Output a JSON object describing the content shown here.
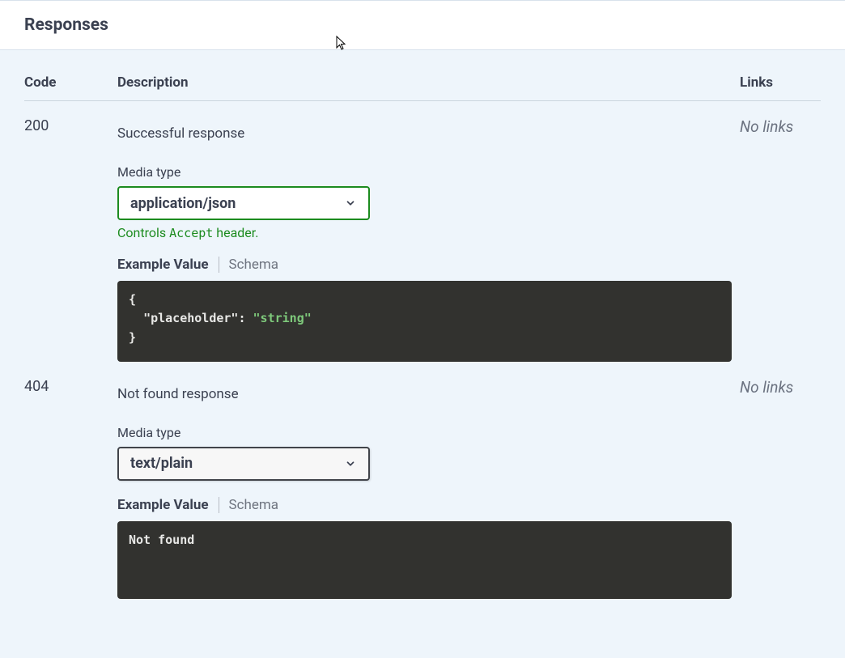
{
  "section_title": "Responses",
  "headers": {
    "code": "Code",
    "description": "Description",
    "links": "Links"
  },
  "responses": [
    {
      "code": "200",
      "description": "Successful response",
      "links": "No links",
      "media_type_label": "Media type",
      "media_type_value": "application/json",
      "media_type_active": true,
      "accept_hint_pre": "Controls ",
      "accept_hint_code": "Accept",
      "accept_hint_post": " header.",
      "tab_active": "Example Value",
      "tab_inactive": "Schema",
      "example_open": "{",
      "example_key": "\"placeholder\"",
      "example_colon": ": ",
      "example_val": "\"string\"",
      "example_close": "}"
    },
    {
      "code": "404",
      "description": "Not found response",
      "links": "No links",
      "media_type_label": "Media type",
      "media_type_value": "text/plain",
      "media_type_active": false,
      "tab_active": "Example Value",
      "tab_inactive": "Schema",
      "example_plain": "Not found"
    }
  ]
}
